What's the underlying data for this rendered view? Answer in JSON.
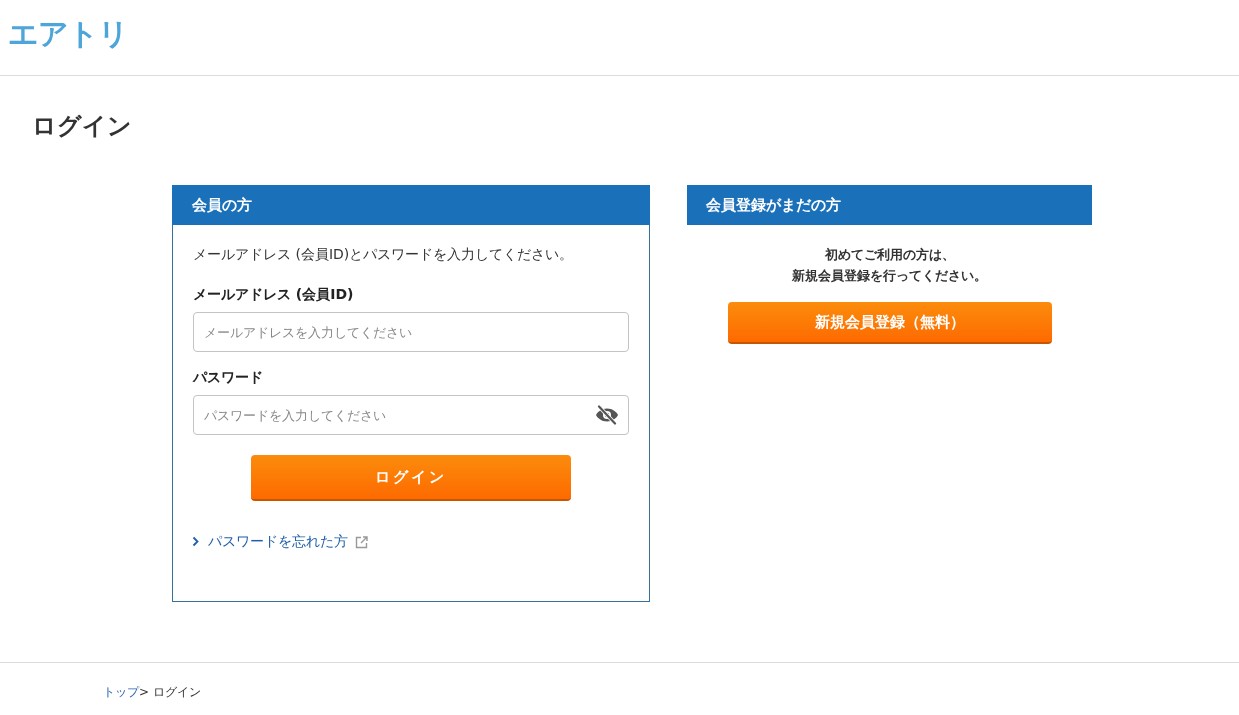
{
  "header": {
    "logo": "エアトリ"
  },
  "page_title": "ログイン",
  "member_panel": {
    "title": "会員の方",
    "intro": "メールアドレス (会員ID)とパスワードを入力してください。",
    "fields": [
      {
        "kind": "email",
        "label": "メールアドレス (会員ID)",
        "placeholder": "メールアドレスを入力してください"
      },
      {
        "kind": "password",
        "label": "パスワード",
        "placeholder": "パスワードを入力してください",
        "password_visible": false
      }
    ],
    "submit_button": "ログイン",
    "forgot_link": "パスワードを忘れた方"
  },
  "signup_panel": {
    "title": "会員登録がまだの方",
    "message_lines": [
      "初めてご利用の方は、",
      "新規会員登録を行ってください。"
    ],
    "signup_button": "新規会員登録（無料）"
  },
  "breadcrumb": {
    "items": [
      {
        "label": "トップ",
        "kind": "link"
      },
      {
        "label": "ログイン",
        "kind": "current"
      }
    ],
    "separator": ">"
  }
}
